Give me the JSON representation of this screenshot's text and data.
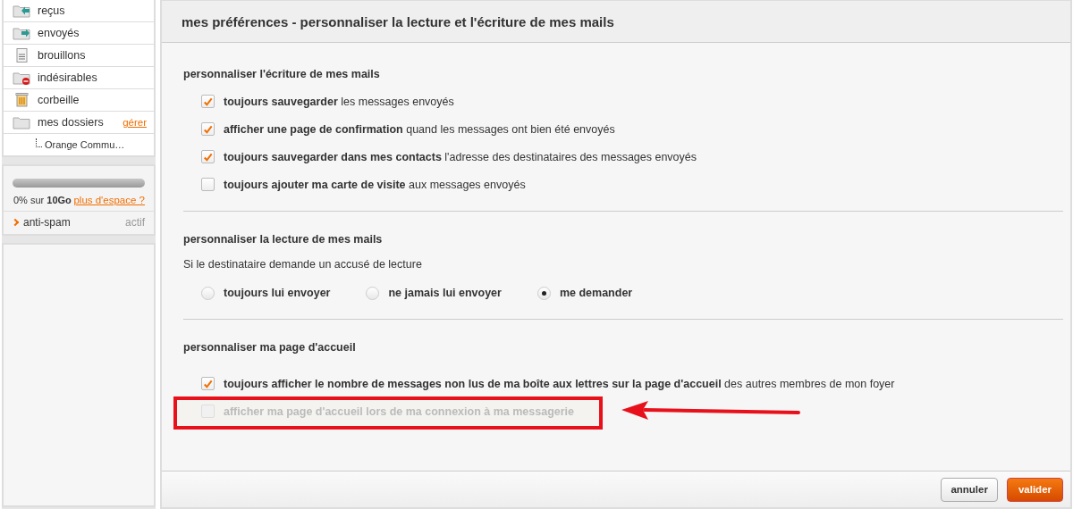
{
  "sidebar": {
    "folders": [
      {
        "label": "reçus",
        "kind": "inbox"
      },
      {
        "label": "envoyés",
        "kind": "sent"
      },
      {
        "label": "brouillons",
        "kind": "drafts"
      },
      {
        "label": "indésirables",
        "kind": "spam"
      },
      {
        "label": "corbeille",
        "kind": "trash"
      },
      {
        "label": "mes dossiers",
        "kind": "folder",
        "link": "gérer",
        "children": [
          {
            "label": "Orange Commu…"
          }
        ]
      }
    ],
    "storage": {
      "level": 0,
      "text": "0% sur **10Go**",
      "link": "plus d'espace ?"
    },
    "antispam": {
      "label": "anti-spam",
      "status": "actif"
    }
  },
  "title": "mes préférences - personnaliser la lecture et l'écriture de mes mails",
  "sections": [
    {
      "kind": "checkboxes",
      "heading": "personnaliser l'écriture de mes mails",
      "options": [
        {
          "text": "**toujours sauvegarder** les messages envoyés",
          "checked": true,
          "disabled": false,
          "highlighted": false
        },
        {
          "text": "**afficher une page de confirmation** quand les messages ont bien été envoyés",
          "checked": true,
          "disabled": false,
          "highlighted": false
        },
        {
          "text": "**toujours sauvegarder dans mes contacts** l'adresse des destinataires des messages envoyés",
          "checked": true,
          "disabled": false,
          "highlighted": false
        },
        {
          "text": "**toujours ajouter ma carte de visite** aux messages envoyés",
          "checked": false,
          "disabled": false,
          "highlighted": false
        }
      ]
    },
    {
      "kind": "radios",
      "heading": "personnaliser la lecture de mes mails",
      "prompt": "Si le destinataire demande un accusé de lecture",
      "options": [
        {
          "label": "toujours lui envoyer",
          "selected": false
        },
        {
          "label": "ne jamais lui envoyer",
          "selected": false
        },
        {
          "label": "me demander",
          "selected": true
        }
      ]
    },
    {
      "kind": "checkboxes",
      "heading": "personnaliser ma page d'accueil",
      "options": [
        {
          "text": "**toujours afficher le nombre de messages non lus de ma boîte aux lettres sur la page d'accueil** des autres membres de mon foyer",
          "checked": true,
          "disabled": false,
          "highlighted": false
        },
        {
          "text": "afficher ma page d'accueil lors de ma connexion à ma messagerie",
          "checked": false,
          "disabled": true,
          "highlighted": true
        }
      ]
    }
  ],
  "buttons": [
    {
      "label": "annuler",
      "kind": "secondary"
    },
    {
      "label": "valider",
      "kind": "primary"
    }
  ]
}
